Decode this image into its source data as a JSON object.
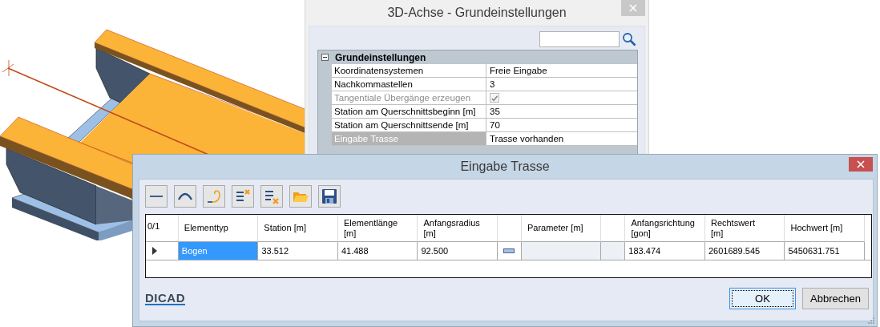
{
  "back_window": {
    "title": "3D-Achse - Grundeinstellungen",
    "property_grid": {
      "category": "Grundeinstellungen",
      "expanded": true,
      "rows": [
        {
          "label": "Koordinatensystemen",
          "kind": "text",
          "value": "Freie Eingabe",
          "disabled": false,
          "selected": false
        },
        {
          "label": "Nachkommastellen",
          "kind": "text",
          "value": "3",
          "disabled": false,
          "selected": false
        },
        {
          "label": "Tangentiale Übergänge erzeugen",
          "kind": "checkbox",
          "checked": true,
          "disabled": true,
          "selected": false
        },
        {
          "label": "Station am Querschnittsbeginn [m]",
          "kind": "text",
          "value": "35",
          "disabled": false,
          "selected": false
        },
        {
          "label": "Station am Querschnittsende [m]",
          "kind": "text",
          "value": "70",
          "disabled": false,
          "selected": false
        },
        {
          "label": "Eingabe Trasse",
          "kind": "text",
          "value": "Trasse vorhanden",
          "disabled": false,
          "selected": true
        }
      ]
    }
  },
  "dialog": {
    "title": "Eingabe Trasse",
    "toolbar": [
      {
        "kind": "line"
      },
      {
        "kind": "arc"
      },
      {
        "kind": "spiral"
      },
      {
        "kind": "delete-top"
      },
      {
        "kind": "delete-bottom"
      },
      {
        "kind": "open"
      },
      {
        "kind": "save"
      }
    ],
    "table": {
      "corner": "0/1",
      "columns": [
        {
          "kind": "text",
          "label": "Elementtyp"
        },
        {
          "kind": "text",
          "label": "Station [m]"
        },
        {
          "kind": "text",
          "label": "Elementlänge\n[m]"
        },
        {
          "kind": "text",
          "label": "Anfangsradius\n[m]"
        },
        {
          "kind": "button"
        },
        {
          "kind": "text",
          "label": "Parameter [m]"
        },
        {
          "kind": "blank"
        },
        {
          "kind": "text",
          "label": "Anfangsrichtung\n[gon]"
        },
        {
          "kind": "text",
          "label": "Rechtswert\n[m]"
        },
        {
          "kind": "text",
          "label": "Hochwert [m]"
        }
      ],
      "rows": [
        {
          "current": true,
          "cells": [
            {
              "kind": "text",
              "value": "Bogen",
              "selected": true
            },
            {
              "kind": "text",
              "value": "33.512",
              "selected": false
            },
            {
              "kind": "text",
              "value": "41.488",
              "selected": false
            },
            {
              "kind": "text",
              "value": "92.500",
              "selected": false
            },
            {
              "kind": "button"
            },
            {
              "kind": "disabled"
            },
            {
              "kind": "disabled"
            },
            {
              "kind": "text",
              "value": "183.474",
              "selected": false
            },
            {
              "kind": "text",
              "value": "2601689.545",
              "selected": false
            },
            {
              "kind": "text",
              "value": "5450631.751",
              "selected": false
            }
          ]
        }
      ]
    },
    "logo": "DICAD",
    "buttons": [
      {
        "label": "OK",
        "focused": true
      },
      {
        "label": "Abbrechen",
        "focused": false
      }
    ]
  }
}
